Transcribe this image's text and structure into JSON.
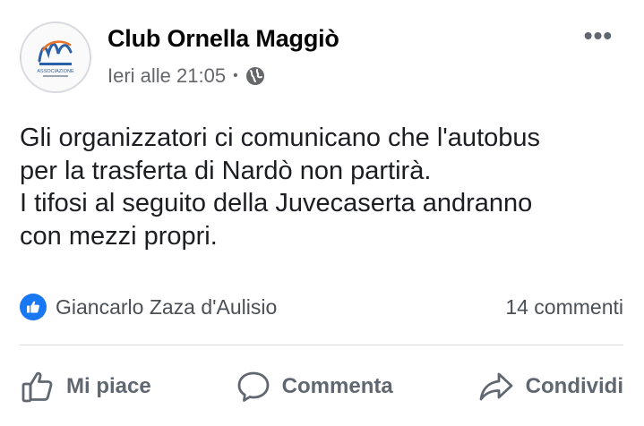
{
  "post": {
    "page_name": "Club Ornella Maggiò",
    "timestamp": "Ieri alle 21:05",
    "separator": "•",
    "privacy_icon": "globe-icon",
    "more_label": "•••",
    "avatar_text": "ASSOCIAZIONE",
    "text_lines": [
      "Gli organizzatori ci comunicano che l'autobus",
      "per la trasferta di Nardò non partirà.",
      "I tifosi al seguito della Juvecaserta andranno",
      "con mezzi propri."
    ]
  },
  "reactions": {
    "icon": "like-reaction-icon",
    "reactor_name": "Giancarlo Zaza d'Aulisio",
    "comment_count": "14 commenti"
  },
  "actions": {
    "like_label": "Mi piace",
    "comment_label": "Commenta",
    "share_label": "Condividi"
  },
  "colors": {
    "brand_blue": "#1877f2",
    "secondary_text": "#65676b",
    "divider": "#dadde1"
  }
}
